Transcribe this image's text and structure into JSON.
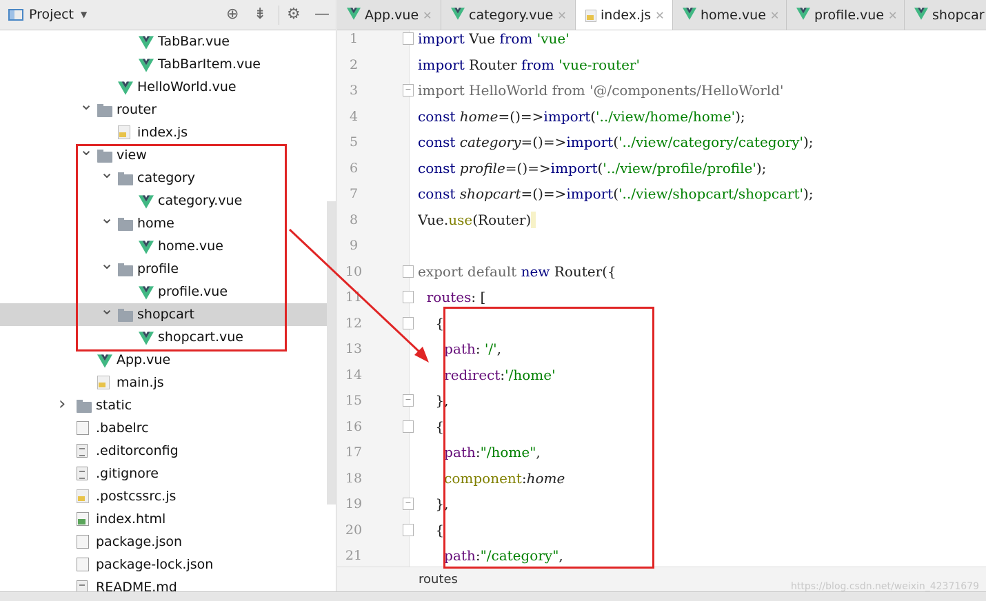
{
  "project_panel": {
    "title": "Project",
    "header_icons": [
      "locate-icon",
      "collapse-icon",
      "gear-icon",
      "minimize-icon"
    ],
    "tree": [
      {
        "label": "TabBar.vue",
        "type": "vue",
        "depth": 7,
        "arrow": ""
      },
      {
        "label": "TabBarItem.vue",
        "type": "vue",
        "depth": 7,
        "arrow": ""
      },
      {
        "label": "HelloWorld.vue",
        "type": "vue",
        "depth": 6,
        "arrow": ""
      },
      {
        "label": "router",
        "type": "folder",
        "depth": 5,
        "arrow": "expanded"
      },
      {
        "label": "index.js",
        "type": "js",
        "depth": 6,
        "arrow": ""
      },
      {
        "label": "view",
        "type": "folder",
        "depth": 5,
        "arrow": "expanded"
      },
      {
        "label": "category",
        "type": "folder",
        "depth": 6,
        "arrow": "expanded"
      },
      {
        "label": "category.vue",
        "type": "vue",
        "depth": 7,
        "arrow": ""
      },
      {
        "label": "home",
        "type": "folder",
        "depth": 6,
        "arrow": "expanded"
      },
      {
        "label": "home.vue",
        "type": "vue",
        "depth": 7,
        "arrow": ""
      },
      {
        "label": "profile",
        "type": "folder",
        "depth": 6,
        "arrow": "expanded"
      },
      {
        "label": "profile.vue",
        "type": "vue",
        "depth": 7,
        "arrow": ""
      },
      {
        "label": "shopcart",
        "type": "folder",
        "depth": 6,
        "arrow": "expanded",
        "selected": true
      },
      {
        "label": "shopcart.vue",
        "type": "vue",
        "depth": 7,
        "arrow": ""
      },
      {
        "label": "App.vue",
        "type": "vue",
        "depth": 5,
        "arrow": ""
      },
      {
        "label": "main.js",
        "type": "js",
        "depth": 5,
        "arrow": ""
      },
      {
        "label": "static",
        "type": "folder",
        "depth": 4,
        "arrow": "collapsed"
      },
      {
        "label": ".babelrc",
        "type": "cfg",
        "depth": 4,
        "arrow": ""
      },
      {
        "label": ".editorconfig",
        "type": "txt",
        "depth": 4,
        "arrow": ""
      },
      {
        "label": ".gitignore",
        "type": "txt",
        "depth": 4,
        "arrow": ""
      },
      {
        "label": ".postcssrc.js",
        "type": "js",
        "depth": 4,
        "arrow": ""
      },
      {
        "label": "index.html",
        "type": "html",
        "depth": 4,
        "arrow": ""
      },
      {
        "label": "package.json",
        "type": "cfg",
        "depth": 4,
        "arrow": ""
      },
      {
        "label": "package-lock.json",
        "type": "cfg",
        "depth": 4,
        "arrow": ""
      },
      {
        "label": "README.md",
        "type": "txt",
        "depth": 4,
        "arrow": ""
      }
    ]
  },
  "editor": {
    "tabs": [
      {
        "label": "App.vue",
        "type": "vue",
        "active": false
      },
      {
        "label": "category.vue",
        "type": "vue",
        "active": false
      },
      {
        "label": "index.js",
        "type": "js",
        "active": true
      },
      {
        "label": "home.vue",
        "type": "vue",
        "active": false
      },
      {
        "label": "profile.vue",
        "type": "vue",
        "active": false
      },
      {
        "label": "shopcar",
        "type": "vue",
        "active": false
      }
    ],
    "line_numbers": [
      "1",
      "2",
      "3",
      "4",
      "5",
      "6",
      "7",
      "8",
      "9",
      "10",
      "11",
      "12",
      "13",
      "14",
      "15",
      "16",
      "17",
      "18",
      "19",
      "20",
      "21"
    ],
    "code_lines": [
      [
        {
          "t": "import",
          "c": "kw"
        },
        {
          "t": " Vue "
        },
        {
          "t": "from",
          "c": "kw"
        },
        {
          "t": " 'vue'",
          "c": "str"
        }
      ],
      [
        {
          "t": "import",
          "c": "kw"
        },
        {
          "t": " Router "
        },
        {
          "t": "from",
          "c": "kw"
        },
        {
          "t": " 'vue-router'",
          "c": "str"
        }
      ],
      [
        {
          "t": "import HelloWorld from '@/components/HelloWorld'",
          "c": "gray"
        }
      ],
      [
        {
          "t": "const",
          "c": "kw"
        },
        {
          "t": " "
        },
        {
          "t": "home",
          "c": "it"
        },
        {
          "t": "=()=>"
        },
        {
          "t": "import",
          "c": "kw"
        },
        {
          "t": "("
        },
        {
          "t": "'../view/home/home'",
          "c": "str"
        },
        {
          "t": ");"
        }
      ],
      [
        {
          "t": "const",
          "c": "kw"
        },
        {
          "t": " "
        },
        {
          "t": "category",
          "c": "it"
        },
        {
          "t": "=()=>"
        },
        {
          "t": "import",
          "c": "kw"
        },
        {
          "t": "("
        },
        {
          "t": "'../view/category/category'",
          "c": "str"
        },
        {
          "t": ");"
        }
      ],
      [
        {
          "t": "const",
          "c": "kw"
        },
        {
          "t": " "
        },
        {
          "t": "profile",
          "c": "it"
        },
        {
          "t": "=()=>"
        },
        {
          "t": "import",
          "c": "kw"
        },
        {
          "t": "("
        },
        {
          "t": "'../view/profile/profile'",
          "c": "str"
        },
        {
          "t": ");"
        }
      ],
      [
        {
          "t": "const",
          "c": "kw"
        },
        {
          "t": " "
        },
        {
          "t": "shopcart",
          "c": "it"
        },
        {
          "t": "=()=>"
        },
        {
          "t": "import",
          "c": "kw"
        },
        {
          "t": "("
        },
        {
          "t": "'../view/shopcart/shopcart'",
          "c": "str"
        },
        {
          "t": ");"
        }
      ],
      [
        {
          "t": "Vue."
        },
        {
          "t": "use",
          "c": "olive"
        },
        {
          "t": "(Router)"
        },
        {
          "t": " ",
          "c": "hl"
        }
      ],
      [
        {
          "t": ""
        }
      ],
      [
        {
          "t": "export default ",
          "c": "gray"
        },
        {
          "t": "new",
          "c": "kw"
        },
        {
          "t": " Router({"
        }
      ],
      [
        {
          "t": "  "
        },
        {
          "t": "routes",
          "c": "prop"
        },
        {
          "t": ": ["
        }
      ],
      [
        {
          "t": "    {"
        }
      ],
      [
        {
          "t": "      "
        },
        {
          "t": "path",
          "c": "prop"
        },
        {
          "t": ": "
        },
        {
          "t": "'/'",
          "c": "str"
        },
        {
          "t": ","
        }
      ],
      [
        {
          "t": "      "
        },
        {
          "t": "redirect",
          "c": "prop"
        },
        {
          "t": ":"
        },
        {
          "t": "'/home'",
          "c": "str"
        }
      ],
      [
        {
          "t": "    },"
        }
      ],
      [
        {
          "t": "    {"
        }
      ],
      [
        {
          "t": "      "
        },
        {
          "t": "path",
          "c": "prop"
        },
        {
          "t": ":"
        },
        {
          "t": "\"/home\"",
          "c": "str"
        },
        {
          "t": ","
        }
      ],
      [
        {
          "t": "      "
        },
        {
          "t": "component",
          "c": "olive"
        },
        {
          "t": ":"
        },
        {
          "t": "home",
          "c": "it"
        }
      ],
      [
        {
          "t": "    },"
        }
      ],
      [
        {
          "t": "    {"
        }
      ],
      [
        {
          "t": "      "
        },
        {
          "t": "path",
          "c": "prop"
        },
        {
          "t": ":"
        },
        {
          "t": "\"/category\"",
          "c": "str"
        },
        {
          "t": ","
        }
      ]
    ],
    "status_breadcrumb": "routes"
  },
  "watermark": "https://blog.csdn.net/weixin_42371679",
  "colors": {
    "annotation": "#e02525",
    "vue_green": "#41b883",
    "vue_dark": "#35495e"
  }
}
